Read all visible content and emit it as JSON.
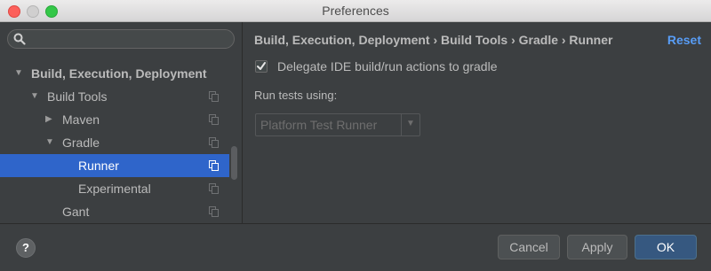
{
  "window": {
    "title": "Preferences"
  },
  "sidebar": {
    "search_placeholder": "",
    "items": [
      {
        "label": "Build, Execution, Deployment",
        "arrow": "▼",
        "level": 0,
        "bold": true,
        "selected": false,
        "copy_icon": false
      },
      {
        "label": "Build Tools",
        "arrow": "▼",
        "level": 1,
        "bold": false,
        "selected": false,
        "copy_icon": true
      },
      {
        "label": "Maven",
        "arrow": "▶",
        "level": 2,
        "bold": false,
        "selected": false,
        "copy_icon": true
      },
      {
        "label": "Gradle",
        "arrow": "▼",
        "level": 2,
        "bold": false,
        "selected": false,
        "copy_icon": true
      },
      {
        "label": "Runner",
        "arrow": "",
        "level": 3,
        "bold": false,
        "selected": true,
        "copy_icon": true
      },
      {
        "label": "Experimental",
        "arrow": "",
        "level": 3,
        "bold": false,
        "selected": false,
        "copy_icon": true
      },
      {
        "label": "Gant",
        "arrow": "",
        "level": 2,
        "bold": false,
        "selected": false,
        "copy_icon": true
      }
    ]
  },
  "main": {
    "breadcrumb": "Build, Execution, Deployment › Build Tools › Gradle › Runner",
    "reset_label": "Reset",
    "delegate_label": "Delegate IDE build/run actions to gradle",
    "delegate_checked": true,
    "run_tests_label": "Run tests using:",
    "run_tests_value": "Platform Test Runner"
  },
  "footer": {
    "help_label": "?",
    "cancel_label": "Cancel",
    "apply_label": "Apply",
    "ok_label": "OK"
  },
  "colors": {
    "background": "#3c3f41",
    "selection": "#2f65ca",
    "link": "#589df6",
    "primary_button": "#365880"
  }
}
